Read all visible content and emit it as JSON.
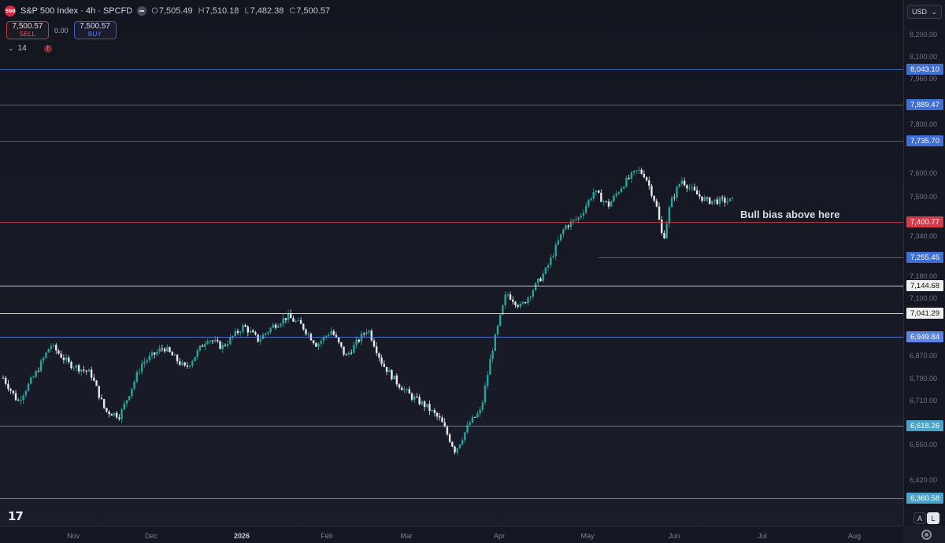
{
  "header": {
    "logo_text": "500",
    "symbol_title": "S&P 500 Index · 4h · SPCFD",
    "ohlc": [
      {
        "key": "O",
        "value": "7,505.49"
      },
      {
        "key": "H",
        "value": "7,510.18"
      },
      {
        "key": "L",
        "value": "7,482.38"
      },
      {
        "key": "C",
        "value": "7,500.57"
      }
    ]
  },
  "trade": {
    "sell_price": "7,500.57",
    "sell_label": "SELL",
    "spread": "0.00",
    "buy_price": "7,500.57",
    "buy_label": "BUY"
  },
  "indicator": {
    "count": "14",
    "warning": "!"
  },
  "price_axis": {
    "currency": "USD",
    "ticks": [
      "8,200.00",
      "8,100.00",
      "7,960.00",
      "7,800.00",
      "7,600.00",
      "7,500.00",
      "7,340.00",
      "7,180.00",
      "7,100.00",
      "6,870.00",
      "6,790.00",
      "6,710.00",
      "6,550.00",
      "6,420.00"
    ]
  },
  "levels": [
    {
      "label": "8,043.10",
      "price": 8043.1,
      "color": "#3f6fd6",
      "text_color": "#ffffff"
    },
    {
      "label": "7,889.47",
      "price": 7889.47,
      "color": "#3f6fd6",
      "text_color": "#ffffff"
    },
    {
      "label": "7,735.70",
      "price": 7735.7,
      "color": "#3f6fd6",
      "text_color": "#ffffff"
    },
    {
      "label": "7,400.77",
      "price": 7400.77,
      "color": "#d83a48",
      "text_color": "#ffffff"
    },
    {
      "label": "7,255.45",
      "price": 7255.45,
      "color": "#3f6fd6",
      "text_color": "#ffffff"
    },
    {
      "label": "7,144.68",
      "price": 7144.68,
      "color": "#f0f0f0",
      "text_color": "#111318"
    },
    {
      "label": "7,041.29",
      "price": 7041.29,
      "color": "#f0f0f0",
      "text_color": "#111318"
    },
    {
      "label": "6,949.84",
      "price": 6949.84,
      "color": "#5b83e8",
      "text_color": "#ffffff"
    },
    {
      "label": "6,618.26",
      "price": 6618.26,
      "color": "#4aa3c8",
      "text_color": "#ffffff"
    },
    {
      "label": "6,360.58",
      "price": 6360.58,
      "color": "#4aa3c8",
      "text_color": "#ffffff"
    }
  ],
  "annotation": "Bull bias above here",
  "time_axis": [
    "Nov",
    "Dec",
    "2026",
    "Feb",
    "Mar",
    "Apr",
    "May",
    "Jun",
    "Jul",
    "Aug"
  ],
  "corner": {
    "auto": "A",
    "log": "L"
  },
  "logo": "17",
  "colors": {
    "up": "#26a69a",
    "down": "#e8e8ee",
    "background": "#171a25"
  },
  "chart_data": {
    "type": "candlestick",
    "timeframe": "4h",
    "series": [
      {
        "name": "S&P 500 Index",
        "x": [
          "Nov",
          "Dec",
          "2026",
          "Feb",
          "Mar",
          "Apr",
          "May",
          "Jun"
        ],
        "values": [
          6750,
          6820,
          6900,
          6960,
          6820,
          6450,
          7400,
          7620
        ]
      }
    ],
    "path_points": [
      [
        0,
        6740
      ],
      [
        0.02,
        6640
      ],
      [
        0.045,
        6760
      ],
      [
        0.065,
        6880
      ],
      [
        0.09,
        6800
      ],
      [
        0.12,
        6760
      ],
      [
        0.14,
        6600
      ],
      [
        0.16,
        6580
      ],
      [
        0.19,
        6800
      ],
      [
        0.22,
        6870
      ],
      [
        0.25,
        6780
      ],
      [
        0.26,
        6820
      ],
      [
        0.28,
        6910
      ],
      [
        0.3,
        6870
      ],
      [
        0.33,
        6960
      ],
      [
        0.35,
        6900
      ],
      [
        0.37,
        6960
      ],
      [
        0.39,
        7000
      ],
      [
        0.41,
        6960
      ],
      [
        0.43,
        6880
      ],
      [
        0.45,
        6940
      ],
      [
        0.47,
        6830
      ],
      [
        0.5,
        6950
      ],
      [
        0.52,
        6800
      ],
      [
        0.54,
        6720
      ],
      [
        0.56,
        6660
      ],
      [
        0.58,
        6620
      ],
      [
        0.6,
        6560
      ],
      [
        0.62,
        6430
      ],
      [
        0.64,
        6550
      ],
      [
        0.655,
        6600
      ],
      [
        0.67,
        6850
      ],
      [
        0.69,
        7100
      ],
      [
        0.71,
        7040
      ],
      [
        0.73,
        7130
      ],
      [
        0.745,
        7200
      ],
      [
        0.77,
        7380
      ],
      [
        0.79,
        7420
      ],
      [
        0.81,
        7530
      ],
      [
        0.83,
        7470
      ],
      [
        0.85,
        7560
      ],
      [
        0.87,
        7620
      ],
      [
        0.88,
        7600
      ],
      [
        0.895,
        7480
      ],
      [
        0.905,
        7320
      ],
      [
        0.915,
        7480
      ],
      [
        0.93,
        7580
      ],
      [
        0.95,
        7520
      ],
      [
        0.965,
        7490
      ]
    ],
    "ylim": [
      6300,
      8260
    ],
    "annotations": [
      "Bull bias above here"
    ]
  }
}
